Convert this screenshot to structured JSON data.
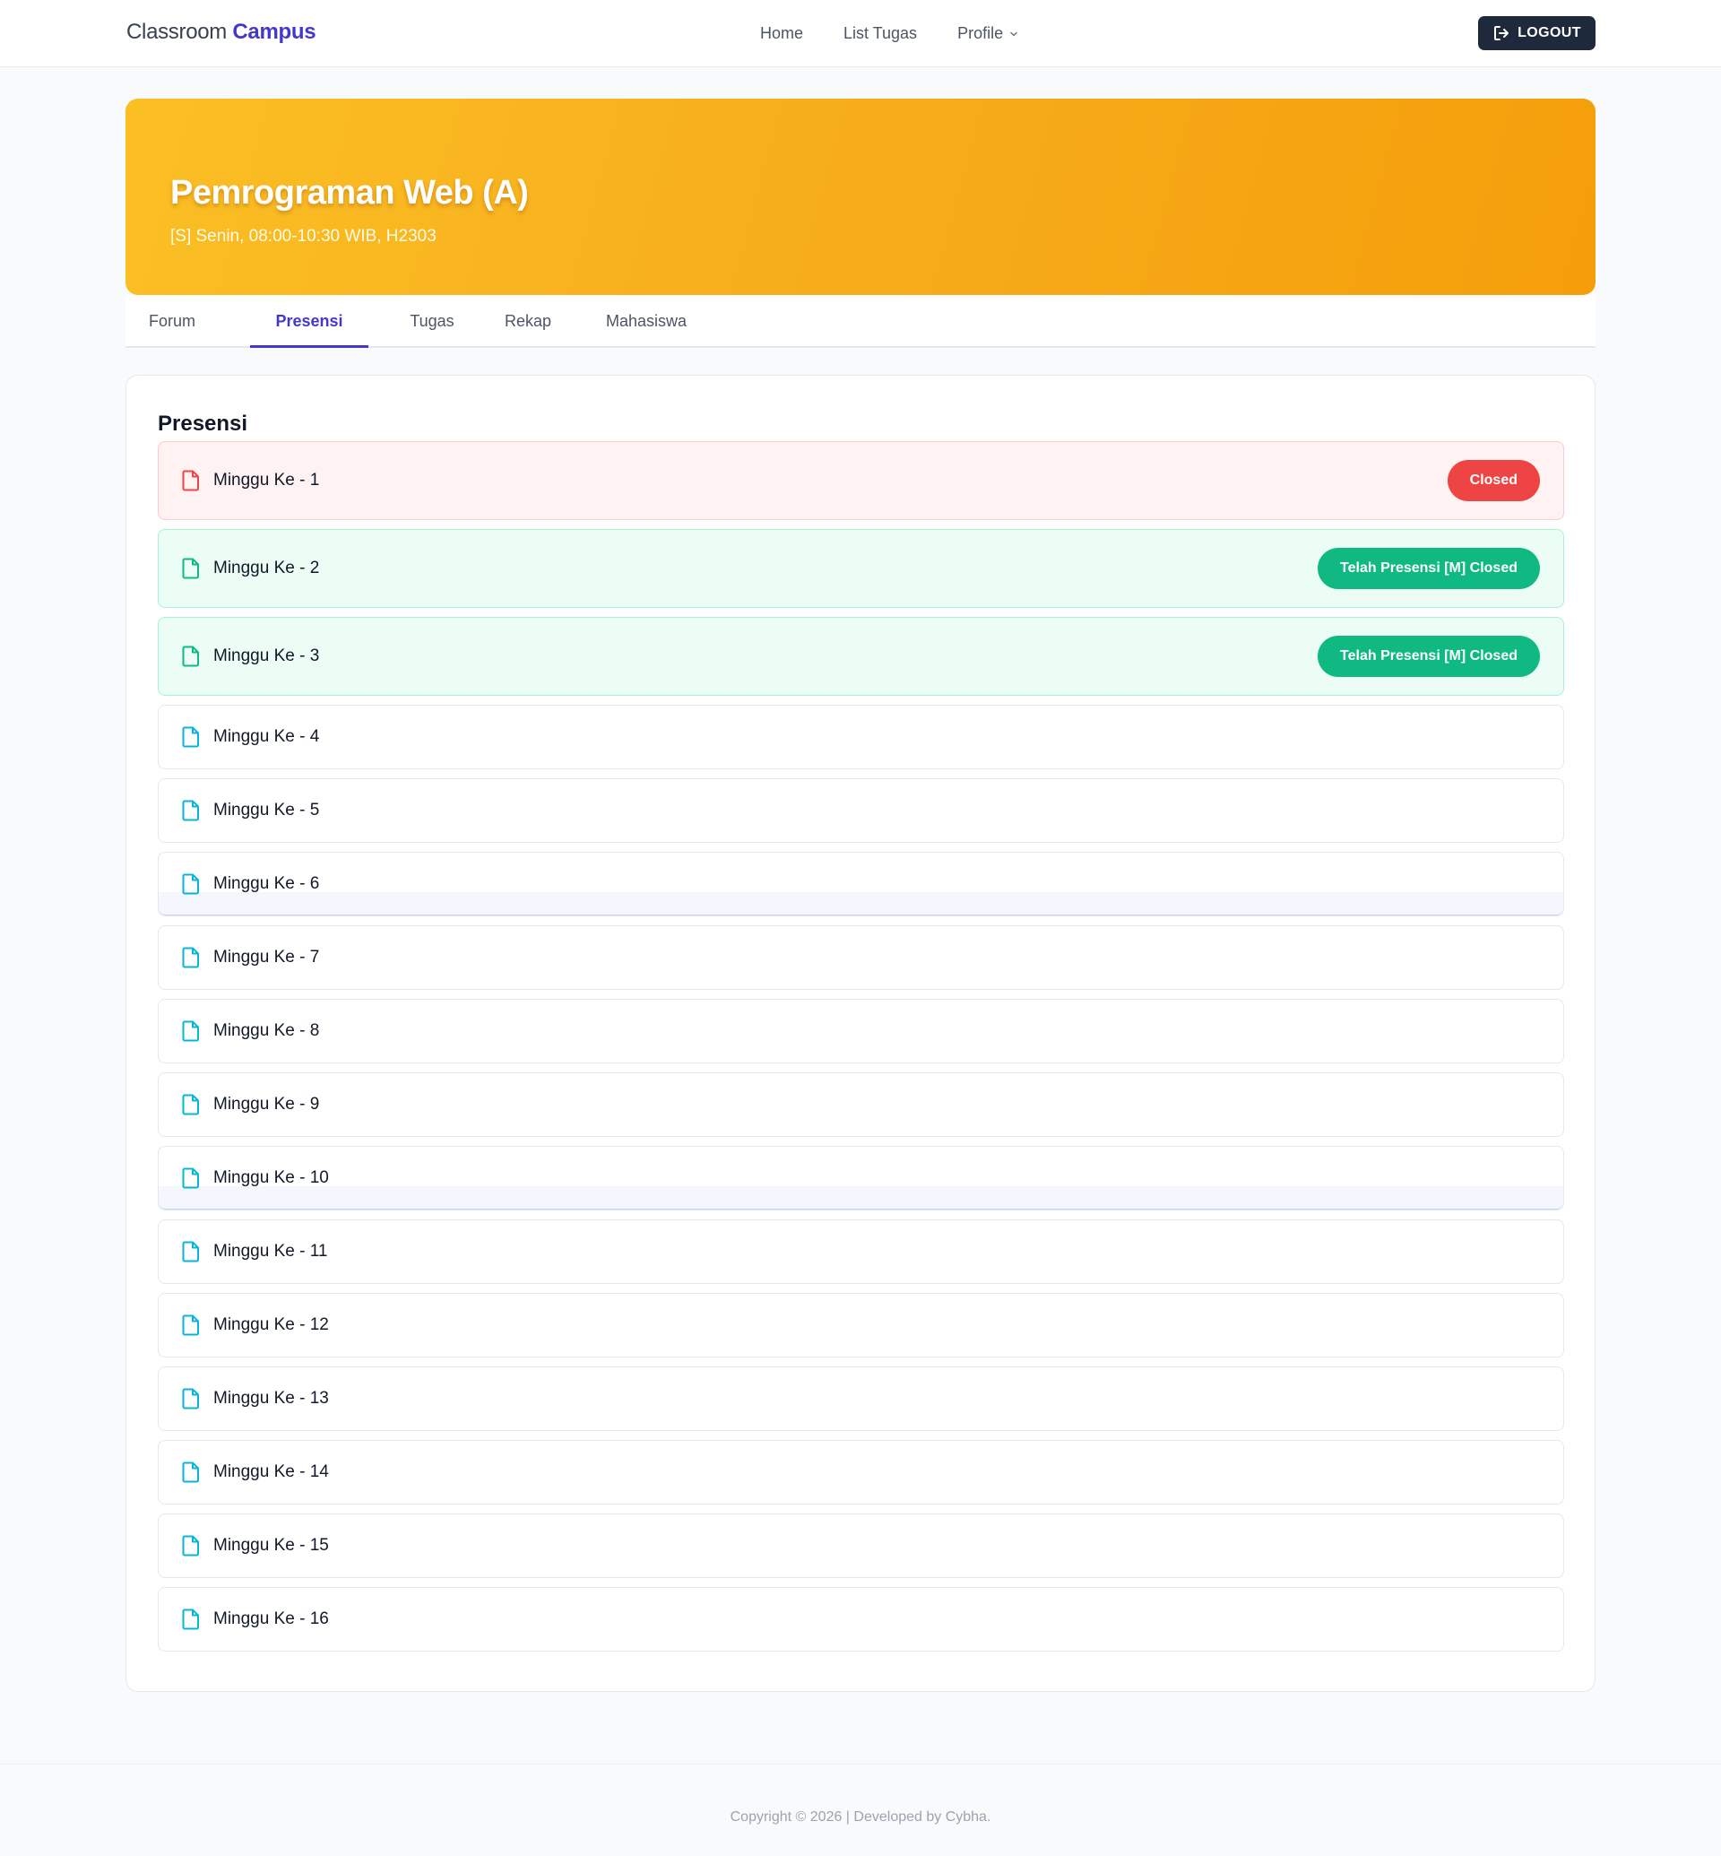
{
  "header": {
    "brand_plain": "Classroom",
    "brand_accent": "Campus",
    "nav": [
      "Home",
      "List Tugas",
      "Profile"
    ],
    "logout_label": "LOGOUT"
  },
  "course": {
    "title": "Pemrograman Web (A)",
    "schedule": "[S] Senin, 08:00-10:30 WIB, H2303"
  },
  "tabs": [
    "Forum",
    "Presensi",
    "Tugas",
    "Rekap",
    "Mahasiswa"
  ],
  "active_tab": "Presensi",
  "presensi": {
    "heading": "Presensi",
    "items": [
      {
        "label": "Minggu Ke - 1",
        "status": "Closed"
      },
      {
        "label": "Minggu Ke - 2",
        "status": "Telah Presensi [M] Closed"
      },
      {
        "label": "Minggu Ke - 3",
        "status": "Telah Presensi [M] Closed"
      },
      {
        "label": "Minggu Ke - 4",
        "status": ""
      },
      {
        "label": "Minggu Ke - 5",
        "status": ""
      },
      {
        "label": "Minggu Ke - 6",
        "status": ""
      },
      {
        "label": "Minggu Ke - 7",
        "status": ""
      },
      {
        "label": "Minggu Ke - 8",
        "status": ""
      },
      {
        "label": "Minggu Ke - 9",
        "status": ""
      },
      {
        "label": "Minggu Ke - 10",
        "status": ""
      },
      {
        "label": "Minggu Ke - 11",
        "status": ""
      },
      {
        "label": "Minggu Ke - 12",
        "status": ""
      },
      {
        "label": "Minggu Ke - 13",
        "status": ""
      },
      {
        "label": "Minggu Ke - 14",
        "status": ""
      },
      {
        "label": "Minggu Ke - 15",
        "status": ""
      },
      {
        "label": "Minggu Ke - 16",
        "status": ""
      }
    ]
  },
  "footer": {
    "text": "Copyright © 2026 | Developed by Cybha."
  },
  "colors": {
    "accent": "#4338ca",
    "hero_start": "#fbbf24",
    "hero_end": "#f59e0b",
    "closed_badge": "#ef4444",
    "done_badge": "#10b981",
    "file_icon_default": "#06b6d4",
    "file_icon_closed": "#ef4444",
    "file_icon_done": "#10b981"
  },
  "icons": {
    "logout": "logout-icon",
    "row": "file-icon",
    "profile_dropdown": "chevron-down-icon"
  }
}
